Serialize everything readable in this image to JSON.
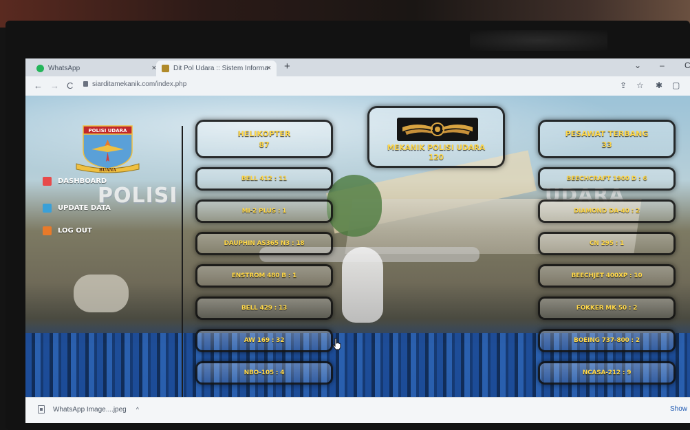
{
  "browser": {
    "tabs": [
      {
        "label": "WhatsApp",
        "favicon": "whatsapp-icon"
      },
      {
        "label": "Dit Pol Udara :: Sistem Informa",
        "favicon": "site-favicon"
      }
    ],
    "new_tab_glyph": "+",
    "close_glyph": "×",
    "url": "siarditamekanik.com/index.php",
    "nav": {
      "back": "←",
      "forward": "→",
      "reload": "C"
    },
    "window_controls": {
      "collapse": "⌄",
      "minimize": "–",
      "close_partial": "C"
    },
    "toolbar_icons": [
      "share-icon",
      "star-icon",
      "extensions-icon",
      "sidepanel-icon"
    ]
  },
  "sidebar": {
    "logo_text": "POLISI UDARA",
    "logo_motto": "BUANA",
    "menu": [
      {
        "label": "DASHBOARD",
        "icon": "home-icon",
        "color": "#e84a4a"
      },
      {
        "label": "UPDATE DATA",
        "icon": "update-icon",
        "color": "#3aa0d8"
      },
      {
        "label": "LOG OUT",
        "icon": "logout-icon",
        "color": "#e87a2a"
      }
    ]
  },
  "background_words": {
    "left": "POLISI",
    "right": "UDARA"
  },
  "dashboard": {
    "helikopter": {
      "title": "HELIKOPTER",
      "count": "87"
    },
    "mekanik": {
      "title": "MEKANIK POLISI UDARA",
      "count": "120"
    },
    "pesawat": {
      "title": "PESAWAT TERBANG",
      "count": "33"
    },
    "helikopter_items": [
      "BELL 412 : 11",
      "MI-2 PLUS : 1",
      "DAUPHIN AS365 N3 : 18",
      "ENSTROM 480 B : 1",
      "BELL 429 : 13",
      "AW 169 : 32",
      "NBO-105 : 4"
    ],
    "pesawat_items": [
      "BEECHCRAFT 1900 D : 6",
      "DIAMOND DA-40 : 2",
      "CN 295 : 1",
      "BEECHJET 400XP : 10",
      "FOKKER MK 50 : 2",
      "BOEING 737-800 : 2",
      "NCASA-212 : 9"
    ]
  },
  "downloads": {
    "file": "WhatsApp Image....jpeg",
    "caret": "^",
    "show_all": "Show"
  },
  "colors": {
    "card_text": "#ffd84a",
    "accent_blue": "#1d3f6c"
  }
}
